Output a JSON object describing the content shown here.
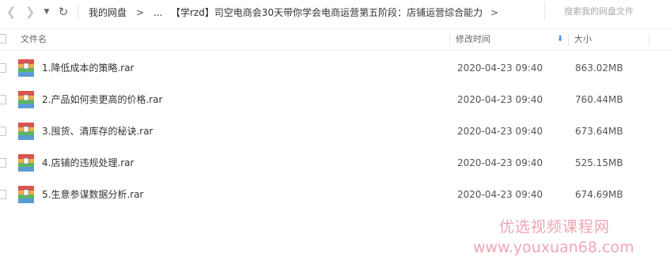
{
  "navigation": {
    "back_icon": "chevron-left-icon",
    "forward_icon": "chevron-right-icon",
    "history_icon": "caret-down-icon",
    "refresh_icon": "refresh-icon"
  },
  "breadcrumb": {
    "home": "我的网盘",
    "separator": ">",
    "ellipsis": "...",
    "current_folder": "【学rzd】司空电商会30天带你学会电商运营第五阶段：店铺运营综合能力"
  },
  "search": {
    "placeholder": "搜索我的网盘文件",
    "value": ""
  },
  "columns": {
    "name": "文件名",
    "modified": "修改时间",
    "size": "大小",
    "sort_icon": "sort-down-arrow-icon",
    "sort_color": "#3b8cff"
  },
  "files": [
    {
      "name": "1.降低成本的策略.rar",
      "modified": "2020-04-23 09:40",
      "size": "863.02MB",
      "icon": "rar-archive-icon"
    },
    {
      "name": "2.产品如何卖更高的价格.rar",
      "modified": "2020-04-23 09:40",
      "size": "760.44MB",
      "icon": "rar-archive-icon"
    },
    {
      "name": "3.囤货、清库存的秘诀.rar",
      "modified": "2020-04-23 09:40",
      "size": "673.64MB",
      "icon": "rar-archive-icon"
    },
    {
      "name": "4.店铺的违规处理.rar",
      "modified": "2020-04-23 09:40",
      "size": "525.15MB",
      "icon": "rar-archive-icon"
    },
    {
      "name": "5.生意参谋数据分析.rar",
      "modified": "2020-04-23 09:40",
      "size": "674.69MB",
      "icon": "rar-archive-icon"
    }
  ],
  "watermark": {
    "title": "优选视频课程网",
    "url": "www.youxuan68.com",
    "color": "#f0a5b4"
  }
}
